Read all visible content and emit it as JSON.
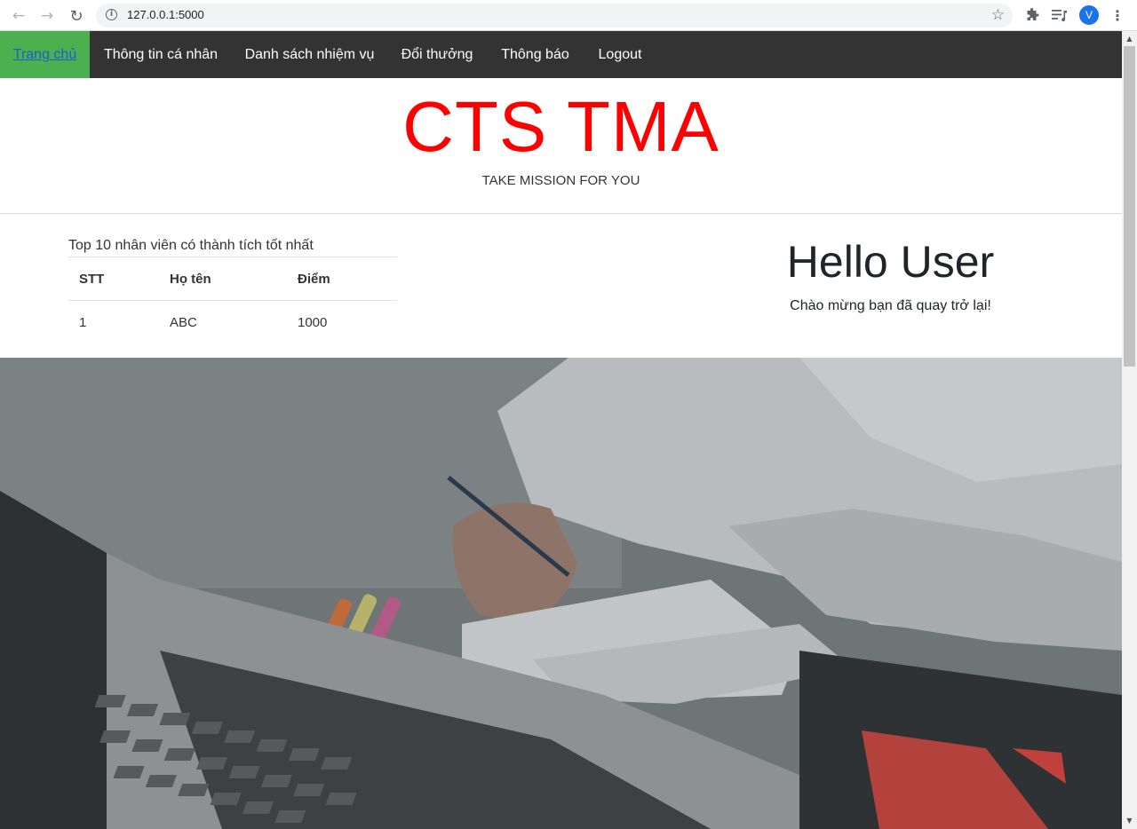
{
  "browser": {
    "url": "127.0.0.1:5000",
    "profile_initial": "V",
    "icons": {
      "back": "arrow-left-icon",
      "forward": "arrow-right-icon",
      "reload": "reload-icon",
      "site_info": "info-icon",
      "bookmark": "star-icon",
      "extensions": "puzzle-icon",
      "queue": "playlist-icon",
      "menu": "kebab-menu-icon"
    }
  },
  "nav": {
    "items": [
      {
        "label": "Trang chủ",
        "active": true
      },
      {
        "label": "Thông tin cá nhân",
        "active": false
      },
      {
        "label": "Danh sách nhiệm vụ",
        "active": false
      },
      {
        "label": "Đổi thưởng",
        "active": false
      },
      {
        "label": "Thông báo",
        "active": false
      },
      {
        "label": "Logout",
        "active": false
      }
    ],
    "bg_color": "#333333",
    "active_color": "#4CAF50"
  },
  "header": {
    "title": "CTS TMA",
    "title_color": "#FF0000",
    "tagline": "TAKE MISSION FOR YOU"
  },
  "leaderboard": {
    "caption": "Top 10 nhân viên có thành tích tốt nhất",
    "columns": [
      "STT",
      "Họ tên",
      "Điểm"
    ],
    "rows": [
      [
        "1",
        "ABC",
        "1000"
      ]
    ]
  },
  "greeting": {
    "title": "Hello User",
    "subtitle": "Chào mừng bạn đã quay trở lại!"
  }
}
